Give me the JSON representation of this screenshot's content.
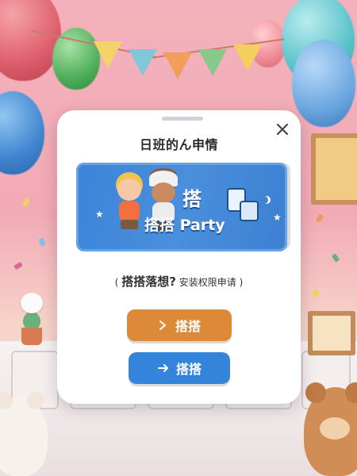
{
  "dialog": {
    "title": "日班的ん申情",
    "banner": {
      "title_top": "搭",
      "title": "搭搭 Party"
    },
    "message": {
      "paren": "(",
      "question": "搭搭落想?",
      "text": "安装权限申请 )"
    },
    "buttons": {
      "primary_label": "搭搭",
      "secondary_label": "搭搭"
    }
  },
  "colors": {
    "primary_button": "#dd8a38",
    "secondary_button": "#3584db",
    "banner": "#3b84d8"
  },
  "icons": {
    "close": "close-icon",
    "primary": "chevron-right-icon",
    "secondary": "arrow-right-icon"
  }
}
